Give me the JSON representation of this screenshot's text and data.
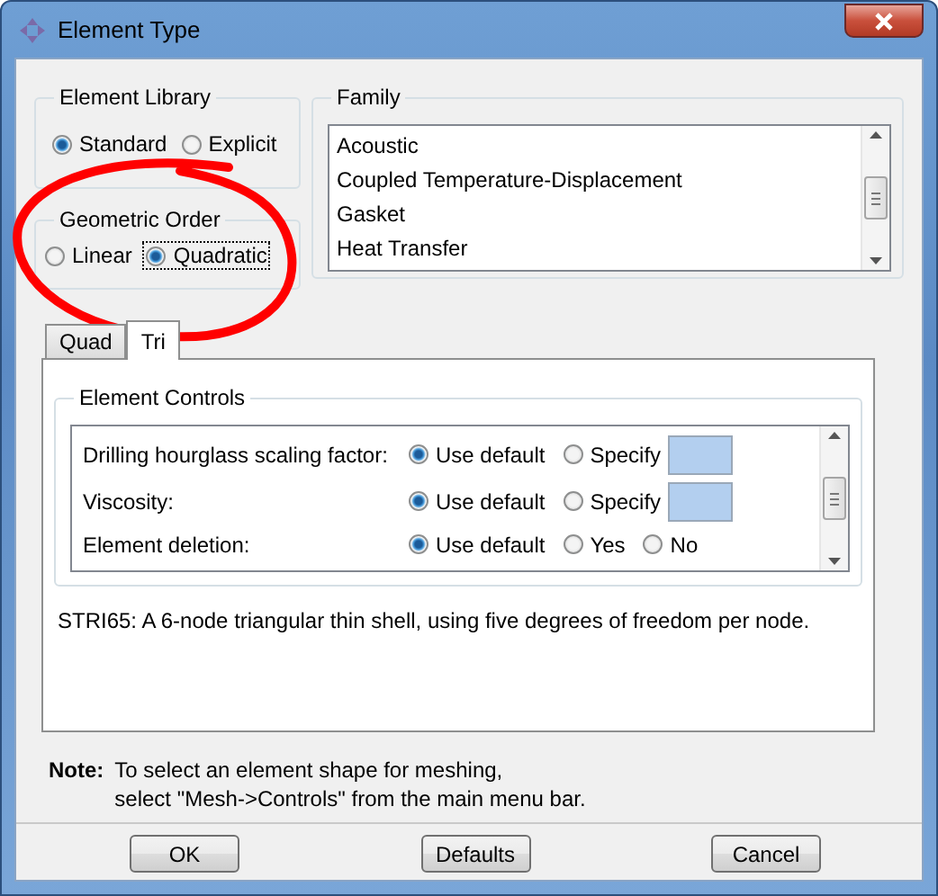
{
  "window": {
    "title": "Element Type"
  },
  "element_library": {
    "title": "Element Library",
    "options": [
      {
        "label": "Standard",
        "selected": true
      },
      {
        "label": "Explicit",
        "selected": false
      }
    ]
  },
  "geometric_order": {
    "title": "Geometric Order",
    "options": [
      {
        "label": "Linear",
        "selected": false,
        "focused": false
      },
      {
        "label": "Quadratic",
        "selected": true,
        "focused": true
      }
    ]
  },
  "family": {
    "title": "Family",
    "items": [
      "Acoustic",
      "Coupled Temperature-Displacement",
      "Gasket",
      "Heat Transfer"
    ]
  },
  "tabs": [
    {
      "label": "Quad",
      "selected": false
    },
    {
      "label": "Tri",
      "selected": true
    }
  ],
  "element_controls": {
    "title": "Element Controls",
    "rows": [
      {
        "label": "Drilling hourglass scaling factor:",
        "kind": "specify",
        "options": [
          {
            "label": "Use default",
            "selected": true
          },
          {
            "label": "Specify",
            "selected": false
          }
        ]
      },
      {
        "label": "Viscosity:",
        "kind": "specify",
        "options": [
          {
            "label": "Use default",
            "selected": true
          },
          {
            "label": "Specify",
            "selected": false
          }
        ]
      },
      {
        "label": "Element deletion:",
        "kind": "choice",
        "options": [
          {
            "label": "Use default",
            "selected": true
          },
          {
            "label": "Yes",
            "selected": false
          },
          {
            "label": "No",
            "selected": false
          }
        ]
      }
    ]
  },
  "description": "STRI65:  A 6-node triangular thin shell, using five degrees of freedom per node.",
  "note": {
    "label": "Note:",
    "lines": [
      "To select an element shape for meshing,",
      "select \"Mesh->Controls\" from the main menu bar."
    ]
  },
  "buttons": [
    "OK",
    "Defaults",
    "Cancel"
  ],
  "annotation": {
    "kind": "ellipse",
    "color": "#ff0000"
  }
}
